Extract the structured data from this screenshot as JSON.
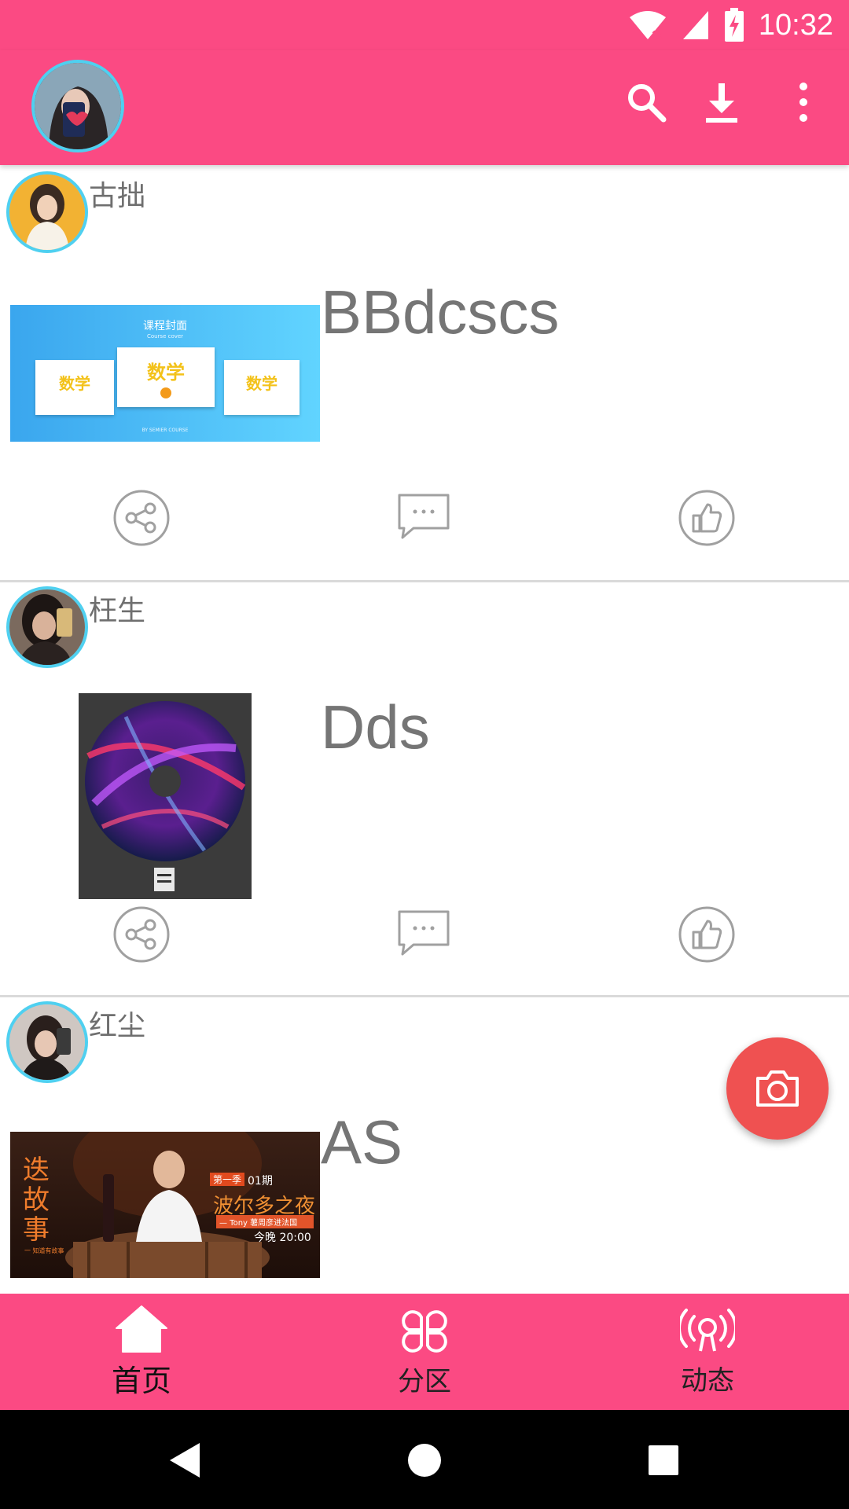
{
  "status_bar": {
    "time": "10:32"
  },
  "toolbar": {
    "avatar_icon": "user-avatar",
    "actions": [
      "search-icon",
      "download-icon",
      "more-vert-icon"
    ]
  },
  "posts": [
    {
      "author": "古拙",
      "title": "BBdcscs",
      "thumb_kind": "course-cover-banner",
      "thumb_text": {
        "heading": "课程封面",
        "sub": "Course cover",
        "card": "数学",
        "footer": "BY SEMIER COURSE"
      }
    },
    {
      "author": "枉生",
      "title": "Dds",
      "thumb_kind": "cd-disc-cover",
      "thumb_text": {}
    },
    {
      "author": "红尘",
      "title": "AS",
      "thumb_kind": "story-event-banner",
      "thumb_text": {
        "big": "迭故事",
        "season": "第一季",
        "episode": "01期",
        "headline": "波尔多之夜",
        "sub": "— Tony 薯周彦进法国",
        "time": "今晚 20:00",
        "tag": "一 知道有故事"
      }
    }
  ],
  "post_actions": [
    "share-icon",
    "comment-icon",
    "like-icon"
  ],
  "fab": {
    "icon": "camera-icon"
  },
  "bottom_nav": [
    {
      "label": "首页",
      "icon": "home-icon",
      "active": true
    },
    {
      "label": "分区",
      "icon": "category-icon",
      "active": false
    },
    {
      "label": "动态",
      "icon": "broadcast-icon",
      "active": false
    }
  ],
  "system_nav": [
    "back-icon",
    "home-circle-icon",
    "recents-icon"
  ],
  "colors": {
    "primary": "#fb4a83",
    "fab": "#ef5151",
    "avatar_ring": "#4fd0f0"
  }
}
